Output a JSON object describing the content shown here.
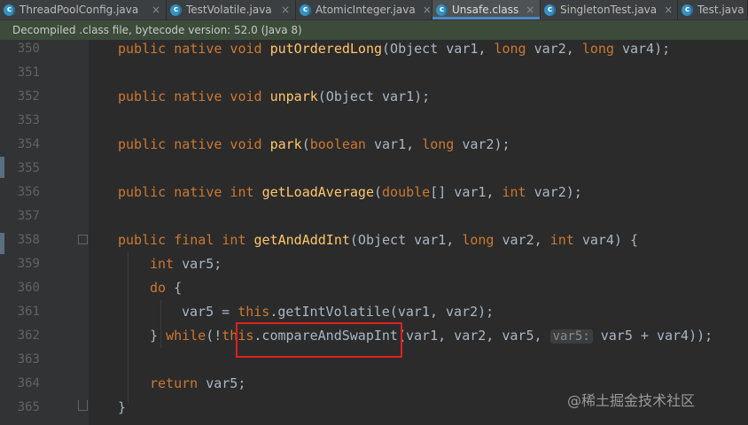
{
  "tabs": [
    {
      "label": "ThreadPoolConfig.java",
      "icon": "c",
      "active": false
    },
    {
      "label": "TestVolatile.java",
      "icon": "c",
      "active": false
    },
    {
      "label": "AtomicInteger.java",
      "icon": "c",
      "active": false
    },
    {
      "label": "Unsafe.class",
      "icon": "c",
      "active": true
    },
    {
      "label": "SingletonTest.java",
      "icon": "c",
      "active": false
    },
    {
      "label": "Test.java",
      "icon": "c",
      "active": false
    }
  ],
  "close_glyph": "×",
  "banner": "Decompiled .class file, bytecode version: 52.0 (Java 8)",
  "line_numbers": [
    "350",
    "351",
    "352",
    "353",
    "354",
    "355",
    "356",
    "357",
    "358",
    "359",
    "360",
    "361",
    "362",
    "363",
    "364",
    "365"
  ],
  "code": {
    "l350": {
      "kw": "public native void ",
      "fn": "putOrderedLong",
      "rest": "(Object var1, ",
      "kw2": "long ",
      "rest2": "var2, ",
      "kw3": "long ",
      "rest3": "var4);"
    },
    "l352": {
      "kw": "public native void ",
      "fn": "unpark",
      "rest": "(Object var1);"
    },
    "l354": {
      "kw": "public native void ",
      "fn": "park",
      "rest": "(",
      "kw2": "boolean ",
      "rest2": "var1, ",
      "kw3": "long ",
      "rest3": "var2);"
    },
    "l356": {
      "kw": "public native int ",
      "fn": "getLoadAverage",
      "rest": "(",
      "kw2": "double",
      "rest2": "[] var1, ",
      "kw3": "int ",
      "rest3": "var2);"
    },
    "l358": {
      "kw": "public final int ",
      "fn": "getAndAddInt",
      "rest": "(Object var1, ",
      "kw2": "long ",
      "rest2": "var2, ",
      "kw3": "int ",
      "rest3": "var4) {"
    },
    "l359": {
      "kw": "int ",
      "rest": "var5;"
    },
    "l360": {
      "kw": "do ",
      "rest": "{"
    },
    "l361": {
      "pre": "var5 = ",
      "kw": "this",
      "rest": ".getIntVolatile(var1, var2);"
    },
    "l362": {
      "pre": "} ",
      "kw": "while",
      "rest": "(!",
      "kw2": "this",
      "rest2": ".compareAndSwapInt(var1, var2, var5, ",
      "hint": "var5:",
      "rest3": " var5 + var4));"
    },
    "l364": {
      "kw": "return ",
      "rest": "var5;"
    },
    "l365": {
      "rest": "}"
    }
  },
  "watermark": "@稀土掘金技术社区"
}
